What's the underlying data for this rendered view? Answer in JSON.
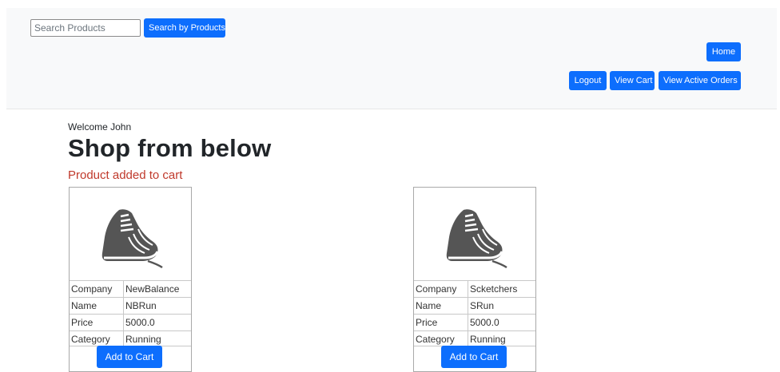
{
  "search": {
    "placeholder": "Search Products",
    "value": "",
    "button_label": "Search by Products"
  },
  "nav": {
    "home_label": "Home",
    "logout_label": "Logout",
    "view_cart_label": "View Cart",
    "view_orders_label": "View Active Orders"
  },
  "main": {
    "welcome": "Welcome John",
    "heading": "Shop from below",
    "alert": "Product added to cart"
  },
  "products": [
    {
      "image_icon": "shoe-icon",
      "rows": [
        {
          "label": "Company",
          "value": "NewBalance"
        },
        {
          "label": "Name",
          "value": "NBRun"
        },
        {
          "label": "Price",
          "value": "5000.0"
        },
        {
          "label": "Category",
          "value": "Running"
        }
      ],
      "button_label": "Add to Cart"
    },
    {
      "image_icon": "shoe-icon",
      "rows": [
        {
          "label": "Company",
          "value": "Scketchers"
        },
        {
          "label": "Name",
          "value": "SRun"
        },
        {
          "label": "Price",
          "value": "5000.0"
        },
        {
          "label": "Category",
          "value": "Running"
        }
      ],
      "button_label": "Add to Cart"
    }
  ],
  "colors": {
    "primary": "#0d6efd",
    "alert": "#c0392b",
    "navbar_bg": "#f8f9fa"
  }
}
